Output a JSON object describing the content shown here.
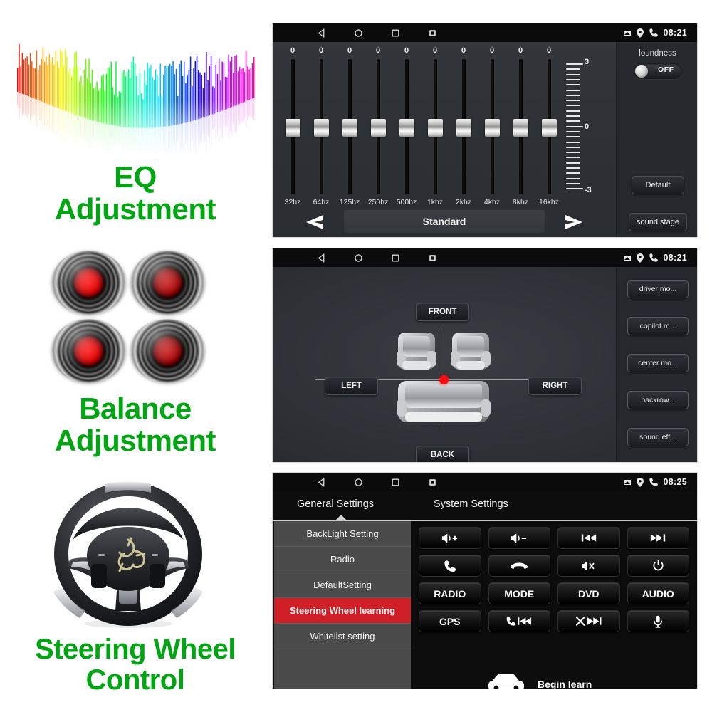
{
  "features": [
    {
      "id": "eq",
      "title": "EQ\nAdjustment",
      "line1": "EQ",
      "line2": "Adjustment"
    },
    {
      "id": "balance",
      "title": "Balance\nAdjustment",
      "line1": "Balance",
      "line2": "Adjustment"
    },
    {
      "id": "swc",
      "title": "Steering Wheel\nControl",
      "line1": "Steering Wheel",
      "line2": "Control"
    }
  ],
  "accent_green": "#00a611",
  "accent_red": "#cf2027",
  "eq_screen": {
    "statusbar": {
      "nav": [
        "back-icon",
        "home-icon",
        "recents-icon",
        "apps-icon"
      ],
      "icons": [
        "sdcard-icon",
        "location-icon",
        "phone-icon"
      ],
      "time": "08:21"
    },
    "band_values": [
      "0",
      "0",
      "0",
      "0",
      "0",
      "0",
      "0",
      "0",
      "0",
      "0"
    ],
    "band_labels": [
      "32hz",
      "64hz",
      "125hz",
      "250hz",
      "500hz",
      "1khz",
      "2khz",
      "4khz",
      "8khz",
      "16khz"
    ],
    "scale_top": "3",
    "scale_mid": "0",
    "scale_bottom": "-3",
    "preset_name": "Standard",
    "prev_label": "prev-preset-arrow",
    "next_label": "next-preset-arrow",
    "sidebar": {
      "loudness_label": "loundness",
      "loudness_state": "OFF",
      "default_label": "Default",
      "sound_stage_label": "sound stage"
    }
  },
  "balance_screen": {
    "statusbar": {
      "nav": [
        "back-icon",
        "home-icon",
        "recents-icon",
        "apps-icon"
      ],
      "icons": [
        "sdcard-icon",
        "location-icon",
        "phone-icon"
      ],
      "time": "08:21"
    },
    "front_label": "FRONT",
    "back_label": "BACK",
    "left_label": "LEFT",
    "right_label": "RIGHT",
    "sidebar_buttons": [
      "driver mo...",
      "copilot m...",
      "center mo...",
      "backrow...",
      "sound eff..."
    ]
  },
  "swc_screen": {
    "statusbar": {
      "nav": [
        "back-icon",
        "home-icon",
        "recents-icon",
        "apps-icon"
      ],
      "icons": [
        "sdcard-icon",
        "location-icon",
        "phone-icon"
      ],
      "time": "08:25"
    },
    "tabs": [
      "General Settings",
      "System Settings"
    ],
    "active_tab": "General Settings",
    "menu": [
      {
        "label": "BackLight Setting",
        "active": false
      },
      {
        "label": "Radio",
        "active": false
      },
      {
        "label": "DefaultSetting",
        "active": false
      },
      {
        "label": "Steering Wheel learning",
        "active": true
      },
      {
        "label": "Whitelist setting",
        "active": false
      }
    ],
    "keys": [
      {
        "name": "volume-up-key",
        "text": "",
        "icon": "volume-plus-icon"
      },
      {
        "name": "volume-down-key",
        "text": "",
        "icon": "volume-minus-icon"
      },
      {
        "name": "previous-track-key",
        "text": "",
        "icon": "previous-icon"
      },
      {
        "name": "next-track-key",
        "text": "",
        "icon": "next-icon"
      },
      {
        "name": "answer-call-key",
        "text": "",
        "icon": "phone-answer-icon"
      },
      {
        "name": "hangup-call-key",
        "text": "",
        "icon": "phone-hangup-icon"
      },
      {
        "name": "mute-key",
        "text": "",
        "icon": "volume-mute-icon"
      },
      {
        "name": "power-key",
        "text": "",
        "icon": "power-icon"
      },
      {
        "name": "radio-key",
        "text": "RADIO",
        "icon": ""
      },
      {
        "name": "mode-key",
        "text": "MODE",
        "icon": ""
      },
      {
        "name": "dvd-key",
        "text": "DVD",
        "icon": ""
      },
      {
        "name": "audio-key",
        "text": "AUDIO",
        "icon": ""
      },
      {
        "name": "gps-key",
        "text": "GPS",
        "icon": ""
      },
      {
        "name": "phone-prev-key",
        "text": "",
        "icon": "phone-previous-icon"
      },
      {
        "name": "shuffle-next-key",
        "text": "",
        "icon": "shuffle-next-icon"
      },
      {
        "name": "voice-key",
        "text": "",
        "icon": "microphone-icon"
      }
    ],
    "begin_learn_label": "Begin learn",
    "car_icon": "car-icon"
  }
}
